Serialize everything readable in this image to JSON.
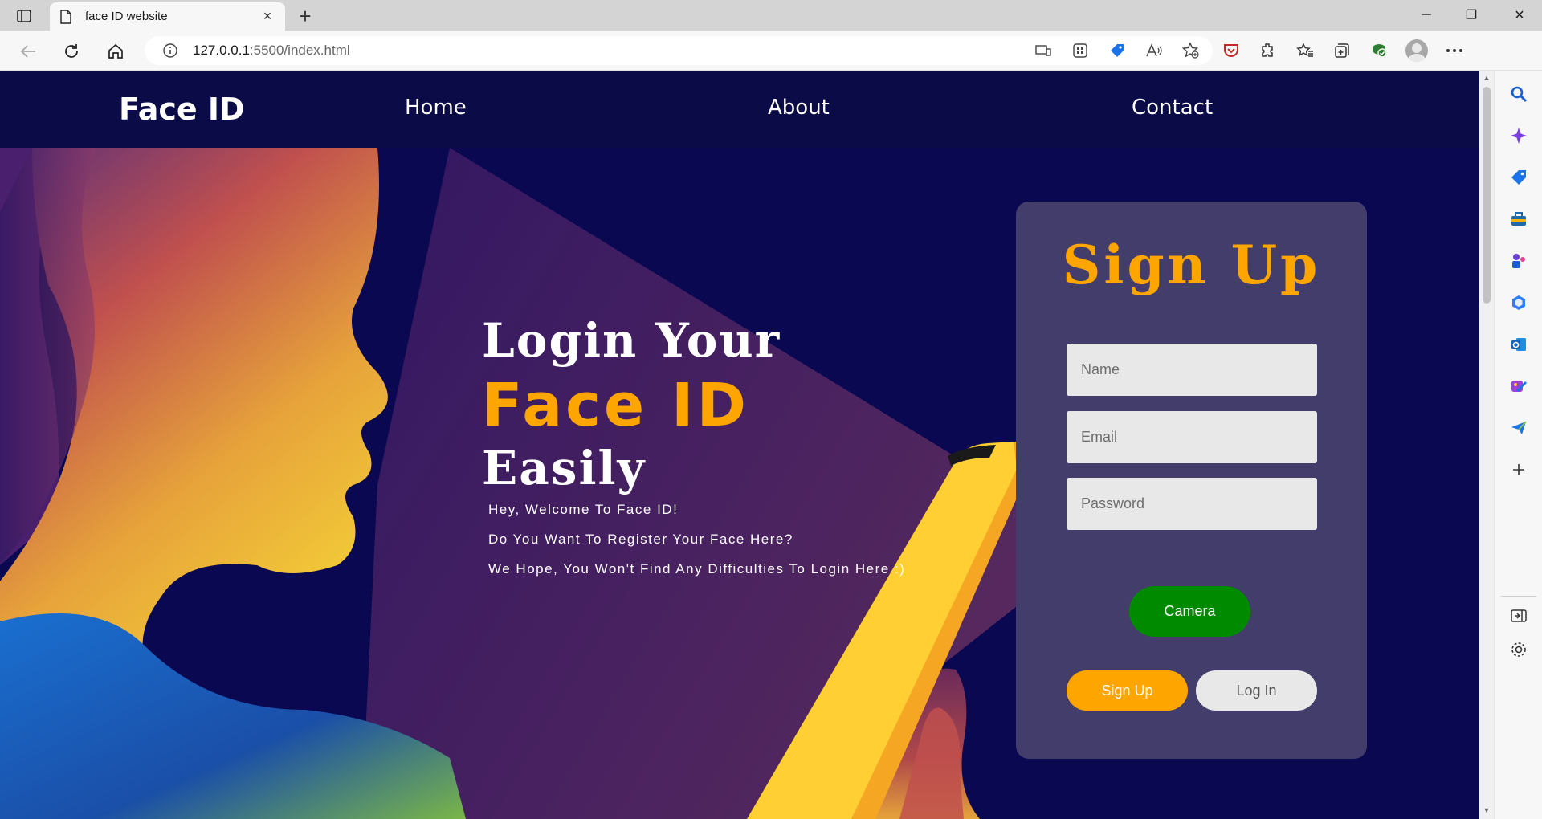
{
  "browser": {
    "tab_title": "face ID website",
    "url_host": "127.0.0.1",
    "url_rest": ":5500/index.html",
    "new_tab_symbol": "+",
    "close_tab_symbol": "×",
    "icons": [
      "tab-actions-icon",
      "doc-icon",
      "back-icon",
      "refresh-icon",
      "home-icon",
      "info-icon",
      "device-icon",
      "apps-icon",
      "coupon-icon",
      "read-aloud-icon",
      "favorite-add-icon",
      "pocket-icon",
      "extensions-icon",
      "favorites-icon",
      "collections-icon",
      "browser-essentials-icon",
      "profile-icon",
      "more-icon"
    ],
    "window_controls": {
      "minimize": "─",
      "restore": "❐",
      "close": "✕"
    }
  },
  "sidebar": {
    "icons": [
      "search-icon",
      "copilot-icon",
      "shopping-icon",
      "tools-icon",
      "games-icon",
      "microsoft365-icon",
      "outlook-icon",
      "designer-icon",
      "send-icon",
      "add-icon",
      "hide-sidebar-icon",
      "settings-icon"
    ]
  },
  "site": {
    "logo": "Face ID",
    "nav": {
      "home": "Home",
      "about": "About",
      "contact": "Contact"
    }
  },
  "hero": {
    "line1": "Login Your",
    "line2": "Face ID",
    "line3": "Easily",
    "sub1": "Hey, Welcome To Face ID!",
    "sub2": "Do You Want To Register Your Face Here?",
    "sub3": "We Hope, You Won't Find Any Difficulties To Login Here :)"
  },
  "signup": {
    "title": "Sign Up",
    "name_placeholder": "Name",
    "email_placeholder": "Email",
    "password_placeholder": "Password",
    "camera_label": "Camera",
    "signup_label": "Sign Up",
    "login_label": "Log In"
  },
  "colors": {
    "header_bg": "#0b0b48",
    "page_bg": "#0a0850",
    "accent_orange": "#ffa500",
    "card_bg": "#433d6c",
    "camera_green": "#008a00",
    "input_bg": "#e8e8e8"
  }
}
